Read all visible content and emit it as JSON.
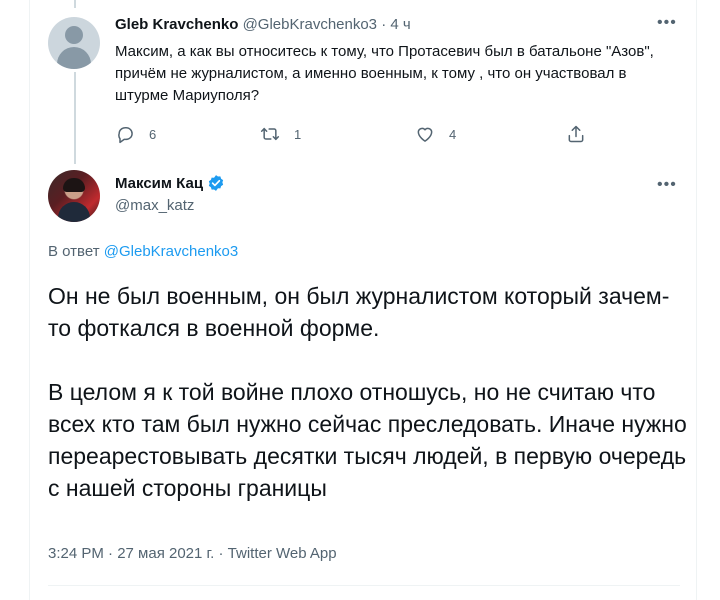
{
  "reply_tweet": {
    "author_name": "Gleb Kravchenko",
    "author_handle": "@GlebKravchenko3",
    "separator": "·",
    "time": "4 ч",
    "text": "Максим, а как вы относитесь к тому, что Протасевич был в батальоне \"Азов\", причём не журналистом, а именно военным, к тому , что он участвовал в штурме Мариуполя?",
    "reply_count": "6",
    "retweet_count": "1",
    "like_count": "4"
  },
  "main_tweet": {
    "author_name": "Максим Кац",
    "author_handle": "@max_katz",
    "verified": true,
    "reply_prefix": "В ответ",
    "reply_to": "@GlebKravchenko3",
    "paragraph1": "Он не был военным, он был журналистом который зачем-то фоткался в военной форме.",
    "paragraph2": "В целом я к той войне плохо отношусь, но не считаю что всех кто там был нужно сейчас преследовать. Иначе нужно переарестовывать десятки тысяч людей, в первую очередь с нашей стороны границы",
    "timestamp": "3:24 PM · 27 мая 2021 г. · Twitter Web App"
  },
  "icons": {
    "more": "more-icon",
    "reply": "reply-icon",
    "retweet": "retweet-icon",
    "like": "like-icon",
    "share": "share-icon",
    "verified": "verified-badge-icon"
  },
  "colors": {
    "accent": "#1d9bf0",
    "text": "#0f1419",
    "secondary": "#536471",
    "line": "#cfd9de"
  }
}
